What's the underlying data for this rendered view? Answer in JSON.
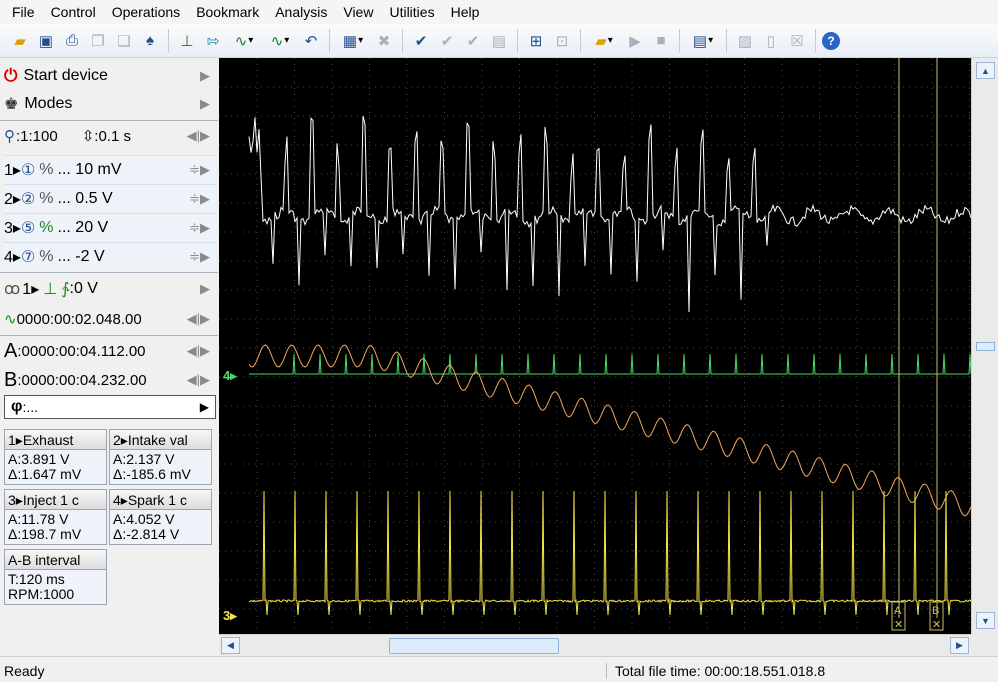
{
  "menu": [
    "File",
    "Control",
    "Operations",
    "Bookmark",
    "Analysis",
    "View",
    "Utilities",
    "Help"
  ],
  "left_panel": {
    "start_device": "Start device",
    "modes": "Modes",
    "zoom": ":1:100",
    "time_div": ":0.1 s",
    "channels": [
      {
        "label": "1▸",
        "num": "①",
        "value": "... 10 mV"
      },
      {
        "label": "2▸",
        "num": "②",
        "value": "... 0.5 V"
      },
      {
        "label": "3▸",
        "num": "⑤",
        "value": "... 20 V"
      },
      {
        "label": "4▸",
        "num": "⑦",
        "value": "... -2 V"
      }
    ],
    "trigger_channel": "1▸",
    "trigger_level": ":0 V",
    "trigger_time": "0000:00:02.048.00",
    "cursor_a_label": "A",
    "cursor_a": ":0000:00:04.112.00",
    "cursor_b_label": "B",
    "cursor_b": ":0000:00:04.232.00",
    "phi": ":..."
  },
  "info_boxes": [
    {
      "header": "1▸Exhaust",
      "a": "A:3.891 V",
      "d": "Δ:1.647 mV"
    },
    {
      "header": "2▸Intake val",
      "a": "A:2.137 V",
      "d": "Δ:-185.6 mV"
    },
    {
      "header": "3▸Inject 1 c",
      "a": "A:11.78 V",
      "d": "Δ:198.7 mV"
    },
    {
      "header": "4▸Spark 1 c",
      "a": "A:4.052 V",
      "d": "Δ:-2.814 V"
    }
  ],
  "interval": {
    "header": "A-B interval",
    "t": "T:120 ms",
    "rpm": "RPM:1000"
  },
  "scope": {
    "marker_4": "4▸",
    "marker_3": "3▸",
    "cursor_a_tag": "A",
    "cursor_b_tag": "B"
  },
  "colors": {
    "ch1": "#ffffff",
    "ch2": "#f2a65a",
    "ch3": "#f4e34a",
    "ch4": "#4cd964",
    "cursor": "#c8c060"
  },
  "status": {
    "left": "Ready",
    "right": "Total file time: 00:00:18.551.018.8"
  }
}
